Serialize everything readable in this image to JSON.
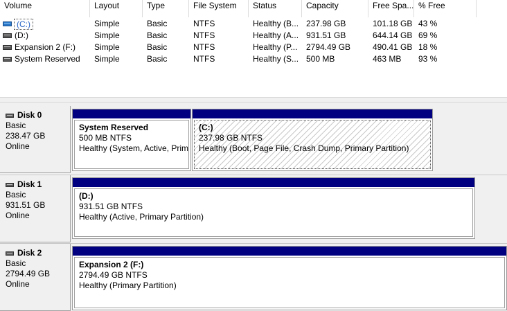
{
  "columns": [
    "Volume",
    "Layout",
    "Type",
    "File System",
    "Status",
    "Capacity",
    "Free Spa...",
    "% Free"
  ],
  "volumes": [
    {
      "name": "(C:)",
      "icon": "system-volume-icon",
      "selected": true,
      "layout": "Simple",
      "type": "Basic",
      "fs": "NTFS",
      "status": "Healthy (B...",
      "capacity": "237.98 GB",
      "free": "101.18 GB",
      "pct": "43 %"
    },
    {
      "name": "(D:)",
      "icon": "volume-icon",
      "selected": false,
      "layout": "Simple",
      "type": "Basic",
      "fs": "NTFS",
      "status": "Healthy (A...",
      "capacity": "931.51 GB",
      "free": "644.14 GB",
      "pct": "69 %"
    },
    {
      "name": "Expansion 2 (F:)",
      "icon": "volume-icon",
      "selected": false,
      "layout": "Simple",
      "type": "Basic",
      "fs": "NTFS",
      "status": "Healthy (P...",
      "capacity": "2794.49 GB",
      "free": "490.41 GB",
      "pct": "18 %"
    },
    {
      "name": "System Reserved",
      "icon": "volume-icon",
      "selected": false,
      "layout": "Simple",
      "type": "Basic",
      "fs": "NTFS",
      "status": "Healthy (S...",
      "capacity": "500 MB",
      "free": "463 MB",
      "pct": "93 %"
    }
  ],
  "disks": [
    {
      "name": "Disk 0",
      "type": "Basic",
      "size": "238.47 GB",
      "state": "Online",
      "partitions": [
        {
          "name": "System Reserved",
          "size": "500 MB NTFS",
          "status": "Healthy (System, Active, Prim"
        },
        {
          "name": "(C:)",
          "size": "237.98 GB NTFS",
          "status": "Healthy (Boot, Page File, Crash Dump, Primary Partition)"
        }
      ]
    },
    {
      "name": "Disk 1",
      "type": "Basic",
      "size": "931.51 GB",
      "state": "Online",
      "partitions": [
        {
          "name": "(D:)",
          "size": "931.51 GB NTFS",
          "status": "Healthy (Active, Primary Partition)"
        }
      ]
    },
    {
      "name": "Disk 2",
      "type": "Basic",
      "size": "2794.49 GB",
      "state": "Online",
      "partitions": [
        {
          "name": "Expansion 2  (F:)",
          "size": "2794.49 GB NTFS",
          "status": "Healthy (Primary Partition)"
        }
      ]
    }
  ],
  "colors": {
    "partition_bar": "#000080",
    "selection_text": "#2a66c7"
  }
}
